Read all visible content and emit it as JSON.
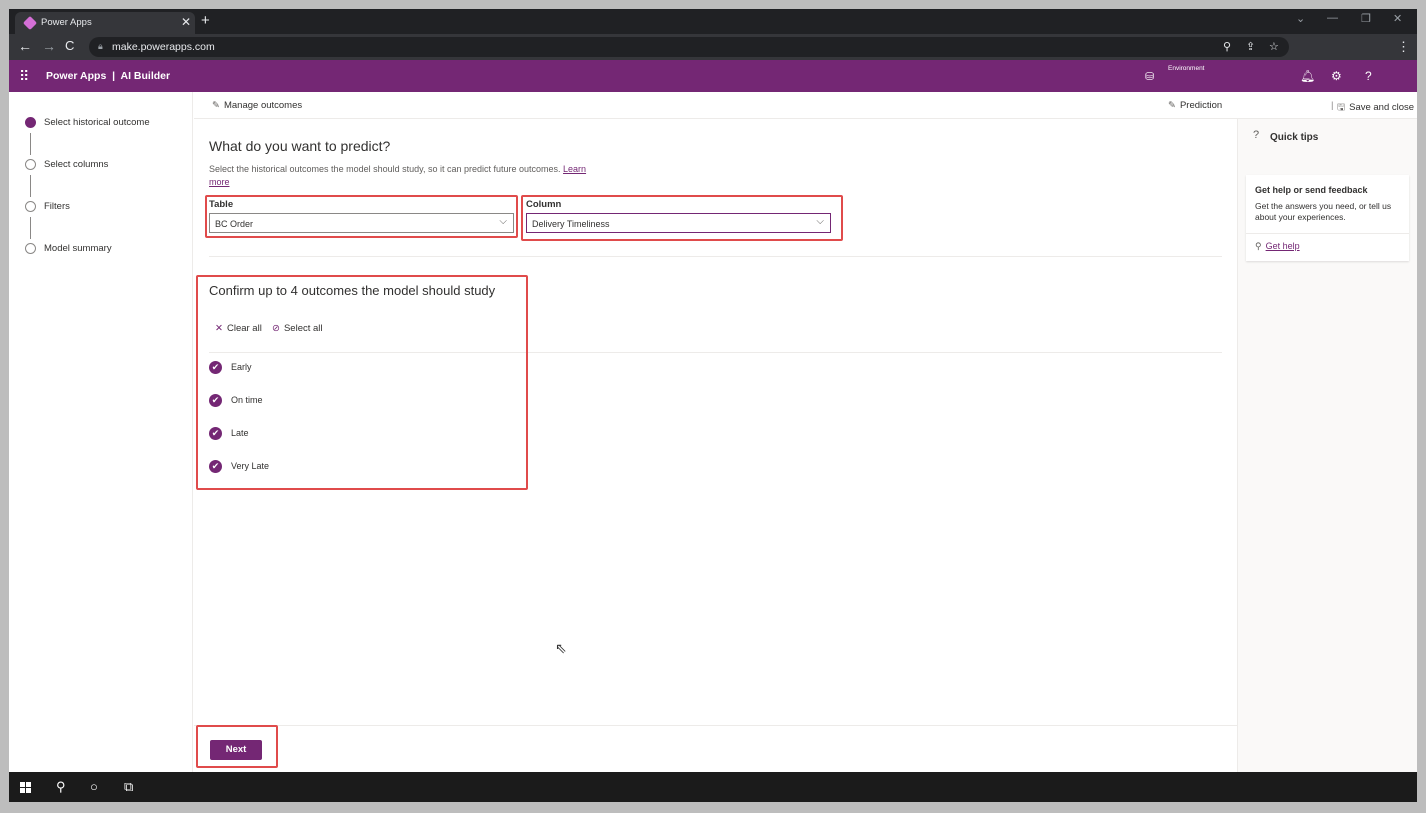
{
  "browser": {
    "tab_title": "Power Apps",
    "tab_close": "✕",
    "new_tab": "+",
    "url": "make.powerapps.com"
  },
  "header": {
    "app_title": "Power Apps  |  AI Builder",
    "environment_label": "Environment"
  },
  "steps": [
    {
      "label": "Select historical outcome",
      "active": true
    },
    {
      "label": "Select columns",
      "active": false
    },
    {
      "label": "Filters",
      "active": false
    },
    {
      "label": "Model summary",
      "active": false
    }
  ],
  "commandbar": {
    "manage_outcomes": "Manage outcomes",
    "prediction": "Prediction",
    "save_and_close": "Save and close"
  },
  "main": {
    "title": "What do you want to predict?",
    "description": "Select the historical outcomes the model should study, so it can predict future outcomes.",
    "learn_more": "Learn more",
    "table_label": "Table",
    "table_value": "BC Order",
    "column_label": "Column",
    "column_value": "Delivery Timeliness",
    "confirm_title": "Confirm up to 4 outcomes the model should study",
    "clear_all": "Clear all",
    "select_all": "Select all",
    "outcomes": [
      {
        "label": "Early",
        "checked": true
      },
      {
        "label": "On time",
        "checked": true
      },
      {
        "label": "Late",
        "checked": true
      },
      {
        "label": "Very Late",
        "checked": true
      }
    ]
  },
  "quick_tips": {
    "title": "Quick tips",
    "card_title": "Get help or send feedback",
    "card_desc": "Get the answers you need, or tell us about your experiences.",
    "card_link": "Get help"
  },
  "footer": {
    "next_label": "Next"
  },
  "colors": {
    "brand": "#742774",
    "highlight": "#e04b4b"
  }
}
